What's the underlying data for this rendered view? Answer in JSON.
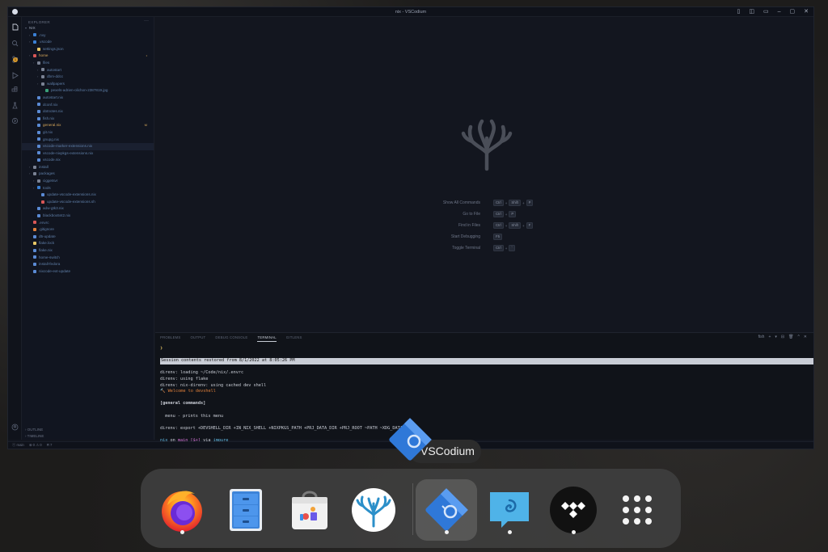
{
  "window": {
    "title": "nix - VSCodium",
    "controls": [
      "▯",
      "◫",
      "▭",
      "–",
      "▢",
      "✕"
    ]
  },
  "activity": {
    "badge": "1"
  },
  "explorer": {
    "title": "EXPLORER",
    "root": "NIX",
    "items": [
      {
        "label": ".nvy",
        "kind": "folder",
        "depth": 1,
        "color": "#3a7fd4"
      },
      {
        "label": ".vscode",
        "kind": "folder",
        "depth": 1,
        "color": "#3a7fd4"
      },
      {
        "label": "settings.json",
        "kind": "json",
        "depth": 2,
        "color": "#e8c766"
      },
      {
        "label": "home",
        "kind": "folder",
        "depth": 1,
        "color": "#d85757",
        "state": "modified",
        "badge": "•"
      },
      {
        "label": "files",
        "kind": "folder",
        "depth": 2,
        "color": "#7a8294"
      },
      {
        "label": "autostart",
        "kind": "folder",
        "depth": 3,
        "color": "#7a8294"
      },
      {
        "label": "dbm-ddcc",
        "kind": "folder",
        "depth": 3,
        "color": "#7a8294"
      },
      {
        "label": "wallpapers",
        "kind": "folder",
        "depth": 3,
        "color": "#7a8294"
      },
      {
        "label": "pexels-adrien-olichon-2387819.jpg",
        "kind": "image",
        "depth": 4,
        "color": "#3aa07a"
      },
      {
        "label": "autostart.nix",
        "kind": "nix",
        "depth": 2,
        "color": "#5a8ad4"
      },
      {
        "label": "dconf.nix",
        "kind": "nix",
        "depth": 2,
        "color": "#5a8ad4"
      },
      {
        "label": "dotnotes.nix",
        "kind": "nix",
        "depth": 2,
        "color": "#5a8ad4"
      },
      {
        "label": "fish.nix",
        "kind": "nix",
        "depth": 2,
        "color": "#5a8ad4"
      },
      {
        "label": "general.nix",
        "kind": "nix",
        "depth": 2,
        "color": "#5a8ad4",
        "state": "modified",
        "badge": "M"
      },
      {
        "label": "git.nix",
        "kind": "nix",
        "depth": 2,
        "color": "#5a8ad4"
      },
      {
        "label": "gnupg.nix",
        "kind": "nix",
        "depth": 2,
        "color": "#5a8ad4"
      },
      {
        "label": "vscode-marker-extensions.nix",
        "kind": "nix",
        "depth": 2,
        "color": "#5a8ad4",
        "selected": true
      },
      {
        "label": "vscode-nixpkgs-extensions.nix",
        "kind": "nix",
        "depth": 2,
        "color": "#5a8ad4"
      },
      {
        "label": "vscode.nix",
        "kind": "nix",
        "depth": 2,
        "color": "#5a8ad4"
      },
      {
        "label": "install",
        "kind": "folder",
        "depth": 1,
        "color": "#7a8294"
      },
      {
        "label": "packages",
        "kind": "folder",
        "depth": 1,
        "color": "#7a8294"
      },
      {
        "label": "ciggetsvr",
        "kind": "folder",
        "depth": 2,
        "color": "#7a8294"
      },
      {
        "label": "tools",
        "kind": "folder",
        "depth": 2,
        "color": "#3a7fd4"
      },
      {
        "label": "update-vscode-extensions.nix",
        "kind": "nix",
        "depth": 3,
        "color": "#5a8ad4"
      },
      {
        "label": "update-vscode-extensions.sh",
        "kind": "sh",
        "depth": 3,
        "color": "#d85757"
      },
      {
        "label": "adw-gtk3.nix",
        "kind": "nix",
        "depth": 2,
        "color": "#5a8ad4"
      },
      {
        "label": "blackbox5nt2.nix",
        "kind": "nix",
        "depth": 2,
        "color": "#5a8ad4"
      },
      {
        "label": ".envrc",
        "kind": "sh",
        "depth": 1,
        "color": "#d85757"
      },
      {
        "label": ".gitignore",
        "kind": "git",
        "depth": 1,
        "color": "#e07f3a"
      },
      {
        "label": "d5-update",
        "kind": "nix",
        "depth": 1,
        "color": "#5a8ad4"
      },
      {
        "label": "flake.lock",
        "kind": "lock",
        "depth": 1,
        "color": "#e8c766"
      },
      {
        "label": "flake.nix",
        "kind": "nix",
        "depth": 1,
        "color": "#5a8ad4"
      },
      {
        "label": "home-switch",
        "kind": "nix",
        "depth": 1,
        "color": "#5a8ad4"
      },
      {
        "label": "install-fedora",
        "kind": "nix",
        "depth": 1,
        "color": "#5a8ad4"
      },
      {
        "label": "nixcode-ext-update",
        "kind": "nix",
        "depth": 1,
        "color": "#5a8ad4"
      }
    ],
    "outline": "OUTLINE",
    "timeline": "TIMELINE"
  },
  "editor": {
    "shortcuts": [
      {
        "label": "Show All Commands",
        "keys": [
          "Ctrl",
          "Shift",
          "P"
        ]
      },
      {
        "label": "Go to File",
        "keys": [
          "Ctrl",
          "P"
        ]
      },
      {
        "label": "Find in Files",
        "keys": [
          "Ctrl",
          "Shift",
          "F"
        ]
      },
      {
        "label": "Start Debugging",
        "keys": [
          "F5"
        ]
      },
      {
        "label": "Toggle Terminal",
        "keys": [
          "Ctrl",
          "`"
        ]
      }
    ]
  },
  "panel": {
    "tabs": [
      "PROBLEMS",
      "OUTPUT",
      "DEBUG CONSOLE",
      "TERMINAL",
      "GITLENS"
    ],
    "active_tab": "TERMINAL",
    "actions": [
      "fish",
      "+",
      "▾",
      "⊟",
      "🗑",
      "^",
      "✕"
    ],
    "terminal": {
      "prompt_symbol": "❯",
      "restored": "Session contents restored from 8/1/2022 at 8:05:26 PM",
      "lines": [
        "direnv: loading ~/Code/nix/.envrc",
        "direnv: using flake",
        "direnv: nix-direnv: using cached dev shell"
      ],
      "welcome": "🔨 Welcome to devshell",
      "section": "[general commands]",
      "menu": "  menu - prints this menu",
      "export": "direnv: export +DEVSHELL_DIR +IN_NIX_SHELL +NIXPKGS_PATH +PRJ_DATA_DIR +PRJ_ROOT ~PATH ~XDG_DATA_DIRS",
      "prompt_dir": "nix",
      "prompt_on": "on",
      "prompt_branch": "main [$+]",
      "prompt_via": "via",
      "prompt_env": "impure"
    }
  },
  "statusbar": {
    "items": [
      "ⓧ main",
      "⊗ 0 ⚠ 0",
      "⛕ 7"
    ]
  },
  "tooltip": {
    "label": "VSCodium"
  },
  "dock": {
    "apps": [
      {
        "name": "Firefox",
        "running": true
      },
      {
        "name": "Files",
        "running": false
      },
      {
        "name": "Software",
        "running": false
      },
      {
        "name": "VSCodium (pinned)",
        "running": false
      },
      {
        "name": "VSCodium",
        "running": true,
        "active": true
      },
      {
        "name": "Chat",
        "running": true
      },
      {
        "name": "Tidal",
        "running": true
      },
      {
        "name": "Show Apps",
        "running": false
      }
    ]
  }
}
